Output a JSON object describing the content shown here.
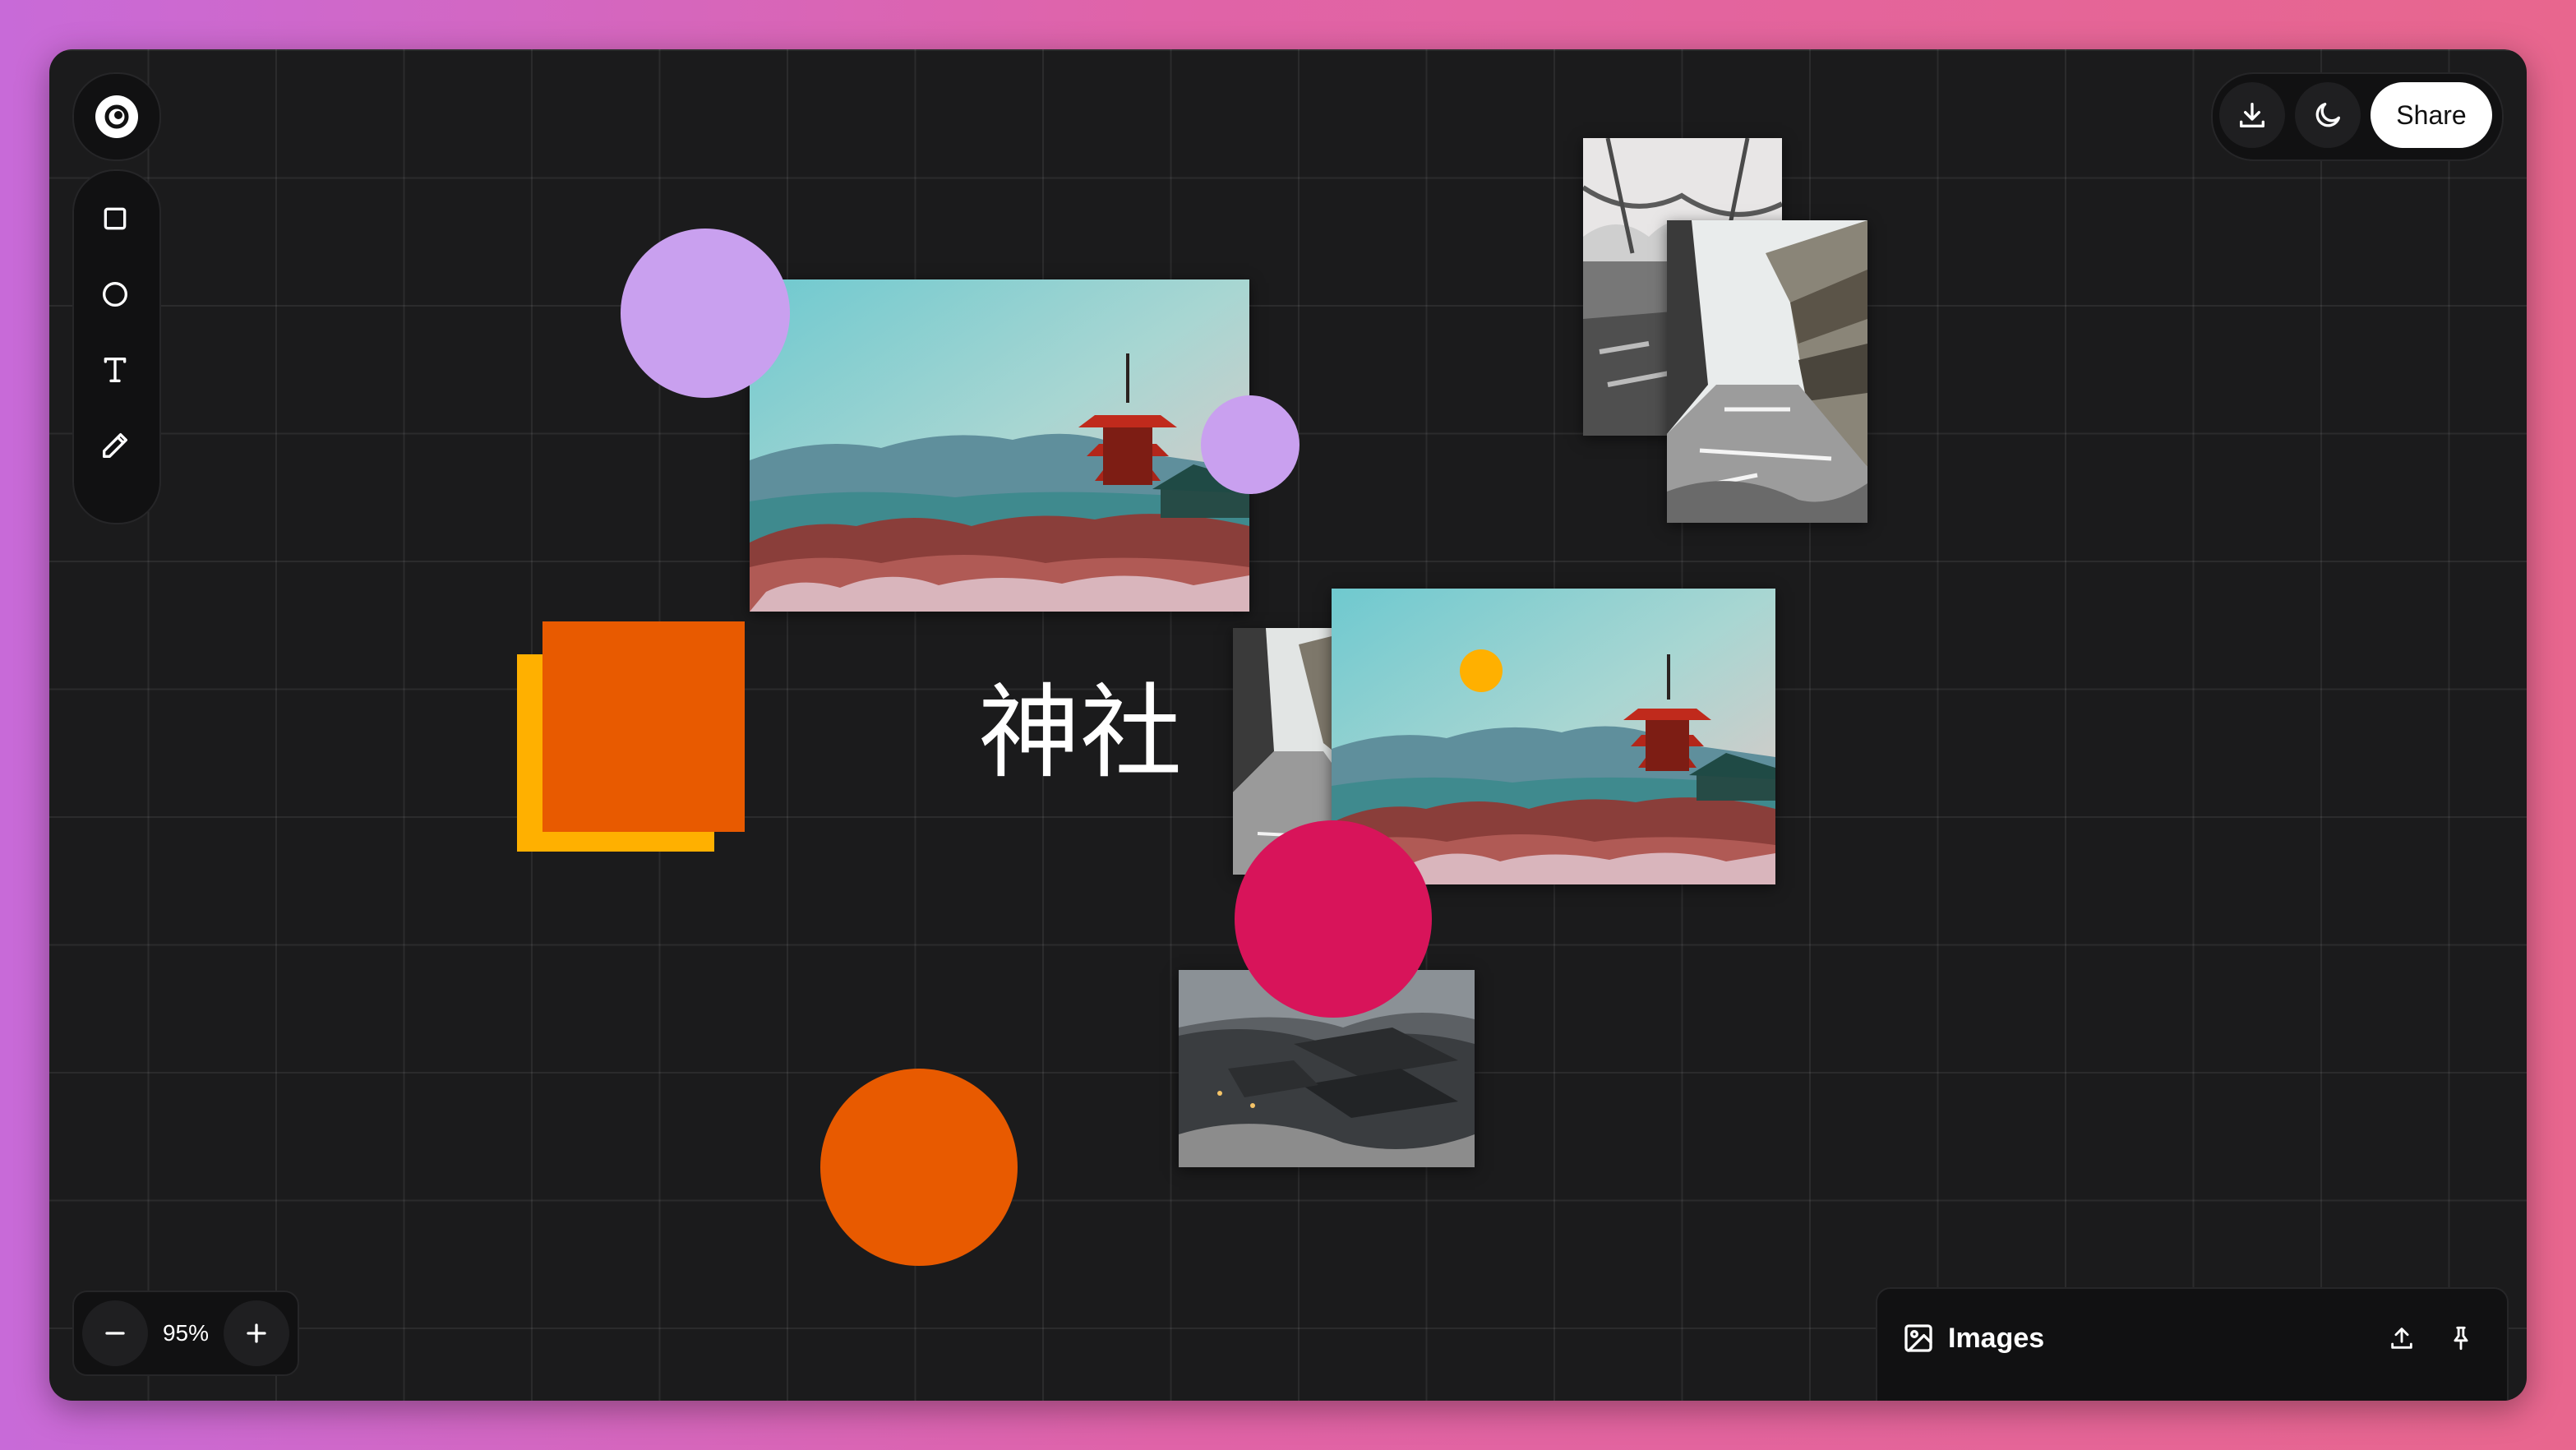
{
  "toolbar": {
    "tools": [
      {
        "name": "rectangle-tool",
        "icon": "square-icon"
      },
      {
        "name": "ellipse-tool",
        "icon": "circle-icon"
      },
      {
        "name": "text-tool",
        "icon": "text-icon"
      },
      {
        "name": "draw-tool",
        "icon": "pencil-icon"
      }
    ],
    "logo_icon": "swirl-logo-icon"
  },
  "top_actions": {
    "download_icon": "download-icon",
    "theme_icon": "moon-icon",
    "share_label": "Share"
  },
  "canvas": {
    "text_label": "神社",
    "colors": {
      "background": "#1b1b1c",
      "lavender": "#c9a0ef",
      "orange": "#e85a00",
      "amber": "#ffb000",
      "crimson": "#d8145a"
    }
  },
  "zoom": {
    "minus_icon": "minus-icon",
    "value": "95%",
    "plus_icon": "plus-icon"
  },
  "images_panel": {
    "icon": "image-icon",
    "title": "Images",
    "upload_icon": "upload-icon",
    "pin_icon": "pin-icon"
  }
}
